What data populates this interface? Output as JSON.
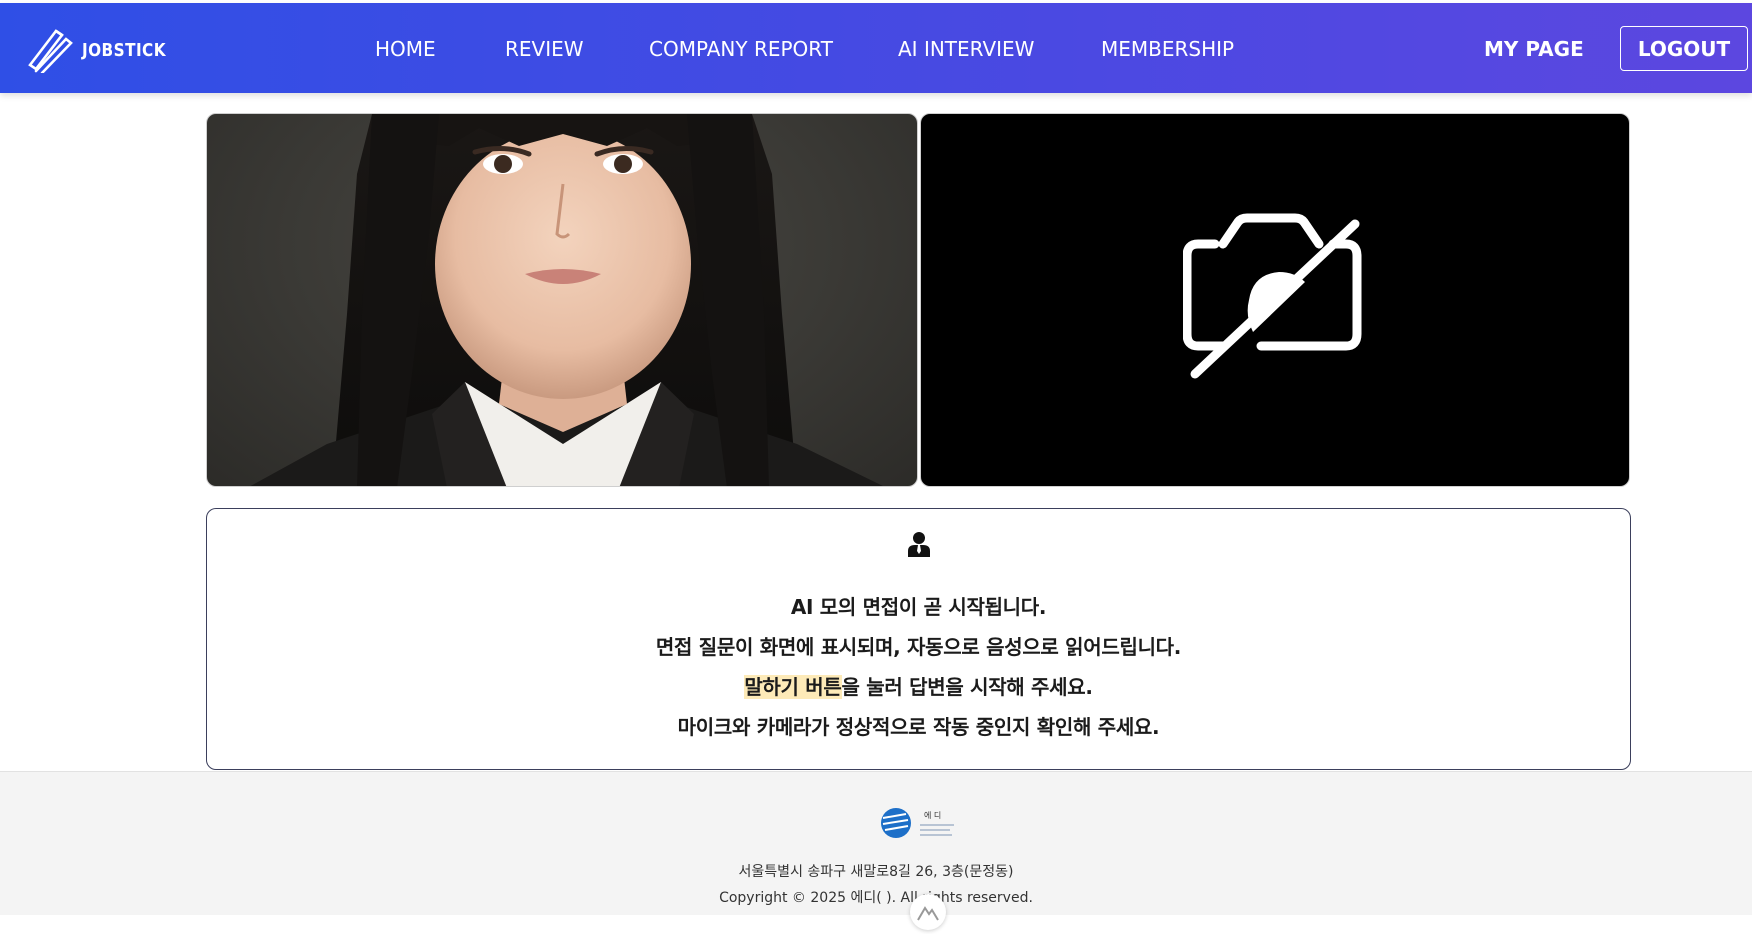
{
  "header": {
    "logo_text": "JOBSTICK",
    "nav": [
      "HOME",
      "REVIEW",
      "COMPANY REPORT",
      "AI INTERVIEW",
      "MEMBERSHIP"
    ],
    "my_page": "MY PAGE",
    "logout": "LOGOUT"
  },
  "video": {
    "left_icon": "interviewer-photo",
    "right_icon": "camera-off-icon"
  },
  "notice": {
    "icon": "interviewer-icon",
    "line1": "AI 모의 면접이 곧 시작됩니다.",
    "line2": "면접 질문이 화면에 표시되며, 자동으로 음성으로 읽어드립니다.",
    "line3_highlight": "말하기 버튼",
    "line3_rest": "을 눌러 답변을 시작해 주세요.",
    "line4": "마이크와 카메라가 정상적으로 작동 중인지 확인해 주세요."
  },
  "footer": {
    "logo_text": "에 디",
    "address": "서울특별시 송파구 새말로8길 26, 3층(문정동)",
    "copyright": "Copyright © 2025 에디(     ). All rights reserved."
  },
  "colors": {
    "header_start": "#2f4fe6",
    "header_end": "#5c47e0",
    "highlight": "#fdeab8",
    "box_border": "#3b3f5c"
  }
}
